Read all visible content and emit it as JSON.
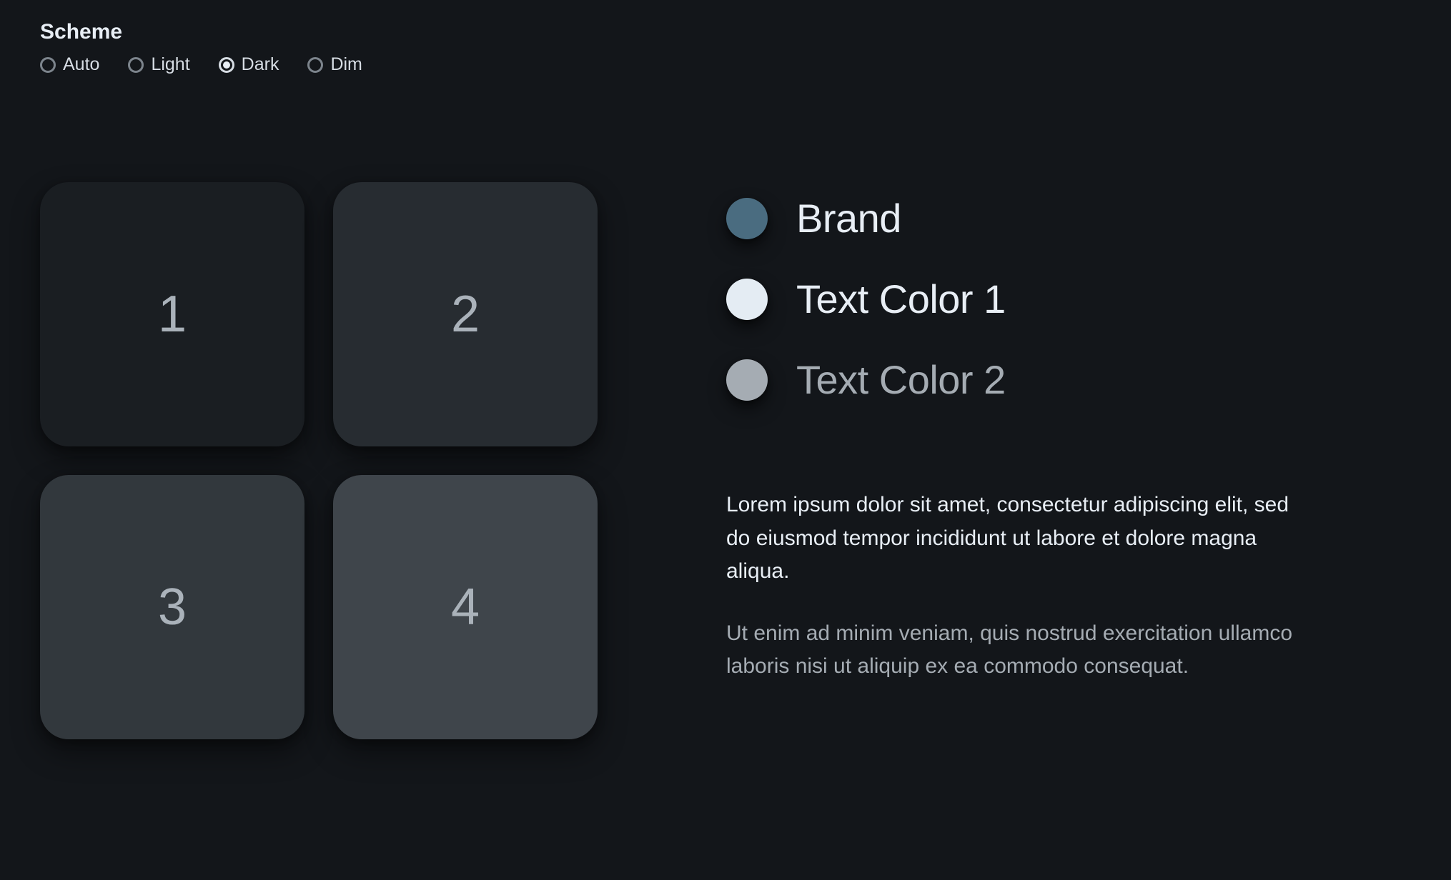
{
  "scheme": {
    "title": "Scheme",
    "options": [
      {
        "label": "Auto",
        "selected": false
      },
      {
        "label": "Light",
        "selected": false
      },
      {
        "label": "Dark",
        "selected": true
      },
      {
        "label": "Dim",
        "selected": false
      }
    ]
  },
  "tiles": [
    {
      "label": "1",
      "bg": "#1a1e22"
    },
    {
      "label": "2",
      "bg": "#272c31"
    },
    {
      "label": "3",
      "bg": "#32383d"
    },
    {
      "label": "4",
      "bg": "#3f454b"
    }
  ],
  "swatches": [
    {
      "name": "Brand",
      "color": "#4a6c80",
      "text_color": "#e8eef5"
    },
    {
      "name": "Text Color 1",
      "color": "#e4ecf3",
      "text_color": "#e8eef5"
    },
    {
      "name": "Text Color 2",
      "color": "#a5acb3",
      "text_color": "#a5acb3"
    }
  ],
  "paragraphs": {
    "p1": "Lorem ipsum dolor sit amet, consectetur adipiscing elit, sed do eiusmod tempor incididunt ut labore et dolore magna aliqua.",
    "p2": "Ut enim ad minim veniam, quis nostrud exercitation ullamco laboris nisi ut aliquip ex ea commodo consequat.",
    "p1_color": "#e8eef5",
    "p2_color": "#a5acb3"
  }
}
